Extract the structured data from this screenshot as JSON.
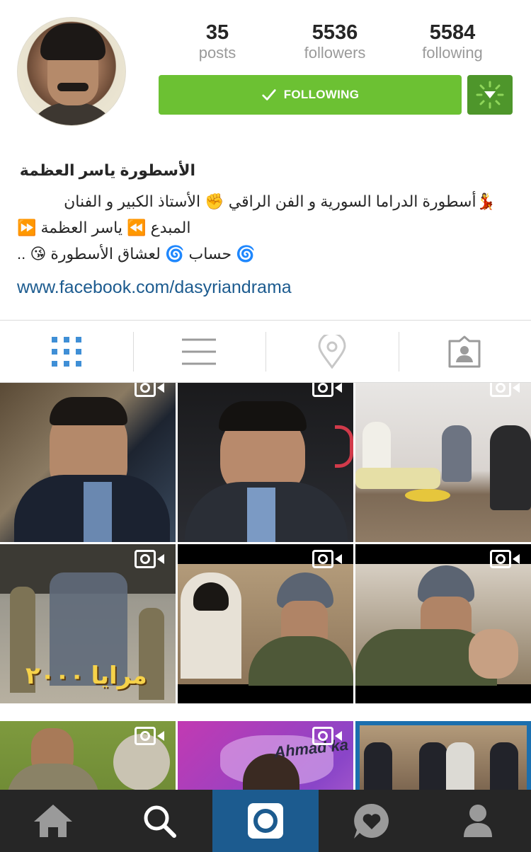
{
  "profile": {
    "name": "الأسطورة ياسر العظمة",
    "bio_lines": [
      "💃أسطورة الدراما السورية و الفن الراقي ✊ الأستاذ الكبير و الفنان",
      "المبدع ⏪ ياسر العظمة ⏩",
      "🌀 حساب 🌀 لعشاق الأسطورة 😘 .."
    ],
    "link": "www.facebook.com/dasyriandrama"
  },
  "stats": {
    "posts": {
      "value": "35",
      "label": "posts"
    },
    "followers": {
      "value": "5536",
      "label": "followers"
    },
    "following": {
      "value": "5584",
      "label": "following"
    }
  },
  "follow_button": {
    "label": "FOLLOWING"
  },
  "tabs": [
    {
      "name": "grid-view",
      "icon": "grid-icon",
      "active": true
    },
    {
      "name": "list-view",
      "icon": "list-icon",
      "active": false
    },
    {
      "name": "map-view",
      "icon": "location-pin-icon",
      "active": false
    },
    {
      "name": "tagged-photos",
      "icon": "tagged-person-icon",
      "active": false
    }
  ],
  "grid": {
    "thumb_texts": [
      "مرايا ٢٠٠٠",
      "Ahmad ka"
    ]
  },
  "bottom_nav": [
    {
      "name": "home",
      "icon": "home-icon"
    },
    {
      "name": "search",
      "icon": "search-icon"
    },
    {
      "name": "camera",
      "icon": "camera-icon",
      "active": true
    },
    {
      "name": "activity",
      "icon": "heart-bubble-icon"
    },
    {
      "name": "profile",
      "icon": "person-icon"
    }
  ],
  "colors": {
    "follow_green": "#6cc133",
    "dropdown_green": "#4e962b",
    "link_blue": "#1c5b8f",
    "active_tab_blue": "#3f8fd6",
    "nav_dark": "#262626",
    "nav_active": "#1c5b8f"
  }
}
